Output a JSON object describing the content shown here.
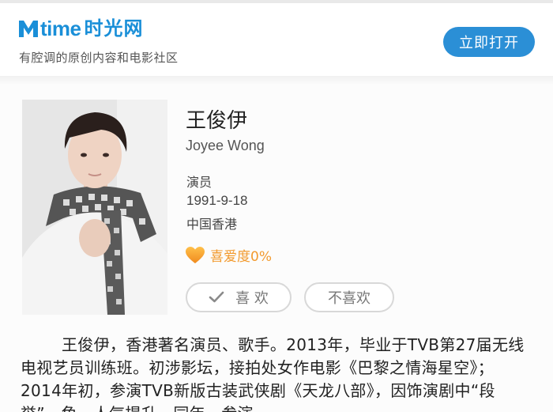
{
  "header": {
    "logo_word": "time",
    "logo_cn": "时光网",
    "tagline": "有腔调的原创内容和电影社区",
    "open_button": "立即打开"
  },
  "person": {
    "name_cn": "王俊伊",
    "name_en": "Joyee Wong",
    "role": "演员",
    "birthdate": "1991-9-18",
    "birthplace": "中国香港",
    "like_label": "喜爱度0%",
    "like_button": "喜 欢",
    "dislike_button": "不喜欢"
  },
  "bio": "王俊伊，香港著名演员、歌手。2013年，毕业于TVB第27届无线电视艺员训练班。初涉影坛，接拍处女作电影《巴黎之情海星空》；2014年初，参演TVB新版古装武侠剧《天龙八部》，因饰演剧中“段誉”一角，人气提升。同年，参演",
  "colors": {
    "brand": "#1a8fd8",
    "button": "#2b8fd6",
    "like": "#f29a2e"
  },
  "icons": {
    "logo": "mtime-m-logo",
    "heart": "heart-icon",
    "check": "check-icon"
  }
}
